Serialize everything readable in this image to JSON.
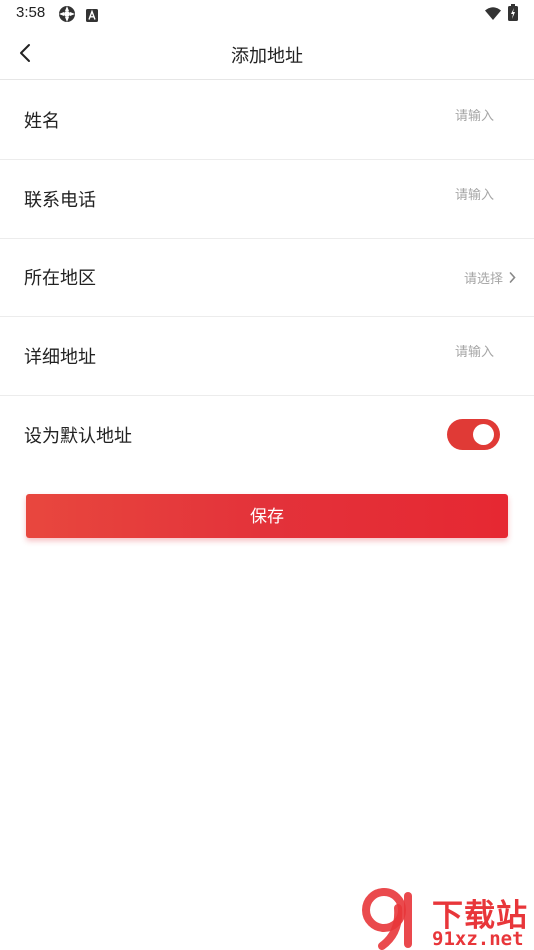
{
  "status_bar": {
    "time": "3:58"
  },
  "header": {
    "title": "添加地址"
  },
  "form": {
    "name": {
      "label": "姓名",
      "value": "",
      "placeholder": "请输入"
    },
    "phone": {
      "label": "联系电话",
      "value": "",
      "placeholder": "请输入"
    },
    "region": {
      "label": "所在地区",
      "placeholder": "请选择"
    },
    "address": {
      "label": "详细地址",
      "value": "",
      "placeholder": "请输入"
    },
    "default": {
      "label": "设为默认地址",
      "enabled": true
    }
  },
  "save_button": {
    "label": "保存"
  },
  "watermark": {
    "title": "下载站",
    "url": "91xz.net"
  },
  "colors": {
    "accent": "#e3323a",
    "divider": "#ececec",
    "placeholder": "#a6a6a6"
  },
  "icons": [
    "settings-gear-icon",
    "a-notification-icon",
    "wifi-icon",
    "battery-icon",
    "back-arrow-icon",
    "chevron-right-icon",
    "watermark-logo-icon"
  ]
}
